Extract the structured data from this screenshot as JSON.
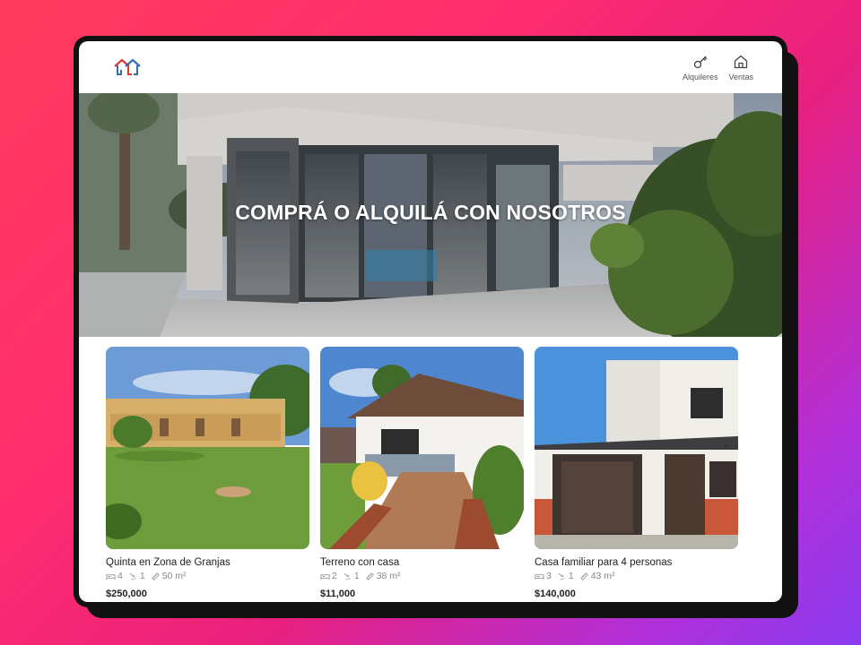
{
  "header": {
    "nav": [
      {
        "label": "Alquileres",
        "icon": "key-icon"
      },
      {
        "label": "Ventas",
        "icon": "house-icon"
      }
    ]
  },
  "hero": {
    "title": "COMPRÁ O ALQUILÁ CON NOSOTROS"
  },
  "listings": [
    {
      "title": "Quinta en Zona de Granjas",
      "beds": "4",
      "baths": "1",
      "area": "50 m²",
      "price": "$250,000"
    },
    {
      "title": "Terreno con casa",
      "beds": "2",
      "baths": "1",
      "area": "38 m²",
      "price": "$11,000"
    },
    {
      "title": "Casa familiar para 4 personas",
      "beds": "3",
      "baths": "1",
      "area": "43 m²",
      "price": "$140,000"
    }
  ],
  "colors": {
    "logo_red": "#d93b3b",
    "logo_blue": "#2f6fb0",
    "text_dark": "#222222",
    "text_muted": "#888888"
  }
}
